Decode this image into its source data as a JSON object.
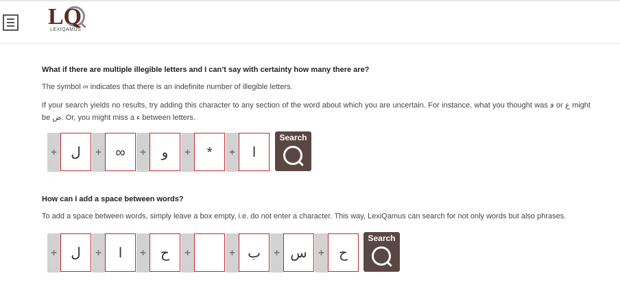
{
  "header": {
    "logo_letters": "LQ",
    "logo_text": "LEXIQAMUS"
  },
  "section1": {
    "question": "What if there are multiple illegible letters and I can’t say with certainty how many there are?",
    "intro": "The symbol ∞ indicates that there is an indefinite number of illegible letters.",
    "details": "If your search yields no results, try adding this character to any section of the word about which you are uncertain. For instance, what you thought was ﻓ or ع might be ﺽ. Or, you might miss a ء between letters.",
    "example_boxes": [
      "ل",
      "∞",
      "و",
      "*",
      "ا"
    ],
    "search_label": "Search"
  },
  "section2": {
    "question": "How can I add a space between words?",
    "intro": "To add a space between words, simply leave a box empty, i.e. do not enter a character. This way, LexiQamus can search for not only words but also phrases.",
    "example_boxes": [
      "ل",
      "ا",
      "ح",
      "",
      "ب",
      "س",
      "ح"
    ],
    "search_label": "Search"
  },
  "plus_symbol": "+",
  "icons": {
    "menu": "hamburger-icon",
    "search": "magnifier-icon"
  },
  "colors": {
    "brand": "#5a2c22",
    "button": "#5a4743",
    "box_border": "#c1272d"
  }
}
